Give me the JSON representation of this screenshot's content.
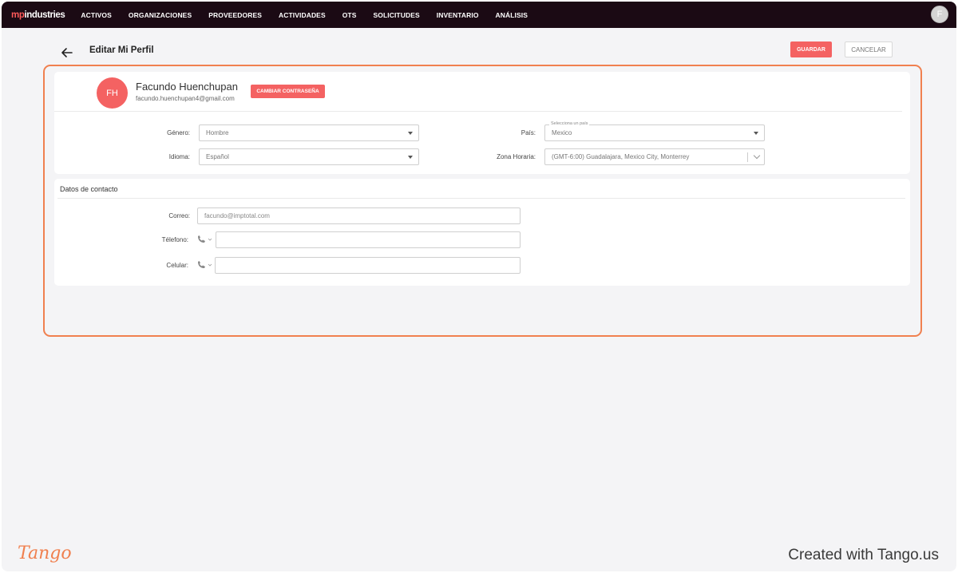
{
  "nav": {
    "logo_prefix": "mp",
    "logo_suffix": "industries",
    "items": [
      "ACTIVOS",
      "ORGANIZACIONES",
      "PROVEEDORES",
      "ACTIVIDADES",
      "OTS",
      "SOLICITUDES",
      "INVENTARIO",
      "ANÁLISIS"
    ],
    "user_initial": "F"
  },
  "header": {
    "title": "Editar Mi Perfil",
    "save_label": "GUARDAR",
    "cancel_label": "CANCELAR"
  },
  "profile": {
    "initials": "FH",
    "name": "Facundo Huenchupan",
    "email": "facundo.huenchupan4@gmail.com",
    "change_password_label": "CAMBIAR CONTRASEÑA",
    "gender_label": "Género:",
    "gender_value": "Hombre",
    "language_label": "Idioma:",
    "language_value": "Español",
    "country_label": "País:",
    "country_floating": "Selecciona un país",
    "country_value": "Mexico",
    "timezone_label": "Zona Horaria:",
    "timezone_value": "(GMT-6:00) Guadalajara, Mexico City, Monterrey"
  },
  "contact": {
    "title": "Datos de contacto",
    "email_label": "Correo:",
    "email_placeholder": "facundo@imptotal.com",
    "phone_label": "Télefono:",
    "mobile_label": "Celular:"
  },
  "footer": {
    "brand": "Tango",
    "credit": "Created with Tango.us"
  },
  "colors": {
    "accent": "#f46262",
    "nav_bg": "#1b0a14",
    "highlight": "#f0804f"
  }
}
